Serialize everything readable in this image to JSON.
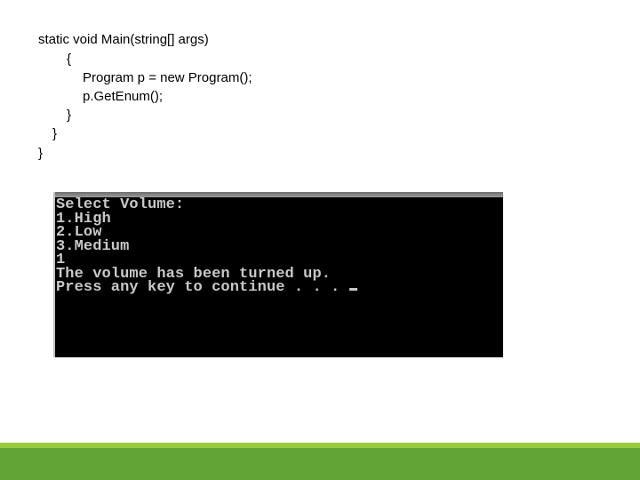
{
  "code": {
    "lines": [
      "static void Main(string[] args)",
      "{",
      "Program p = new Program();",
      "p.GetEnum();",
      "}",
      "}",
      "}"
    ]
  },
  "console": {
    "lines": [
      "Select Volume:",
      "1.High",
      "2.Low",
      "3.Medium",
      "1",
      "The volume has been turned up.",
      "Press any key to continue . . . "
    ]
  },
  "colors": {
    "band_light": "#9bc93f",
    "band_dark": "#62a536",
    "console_bg": "#000000",
    "console_text": "#c8c8c8"
  }
}
